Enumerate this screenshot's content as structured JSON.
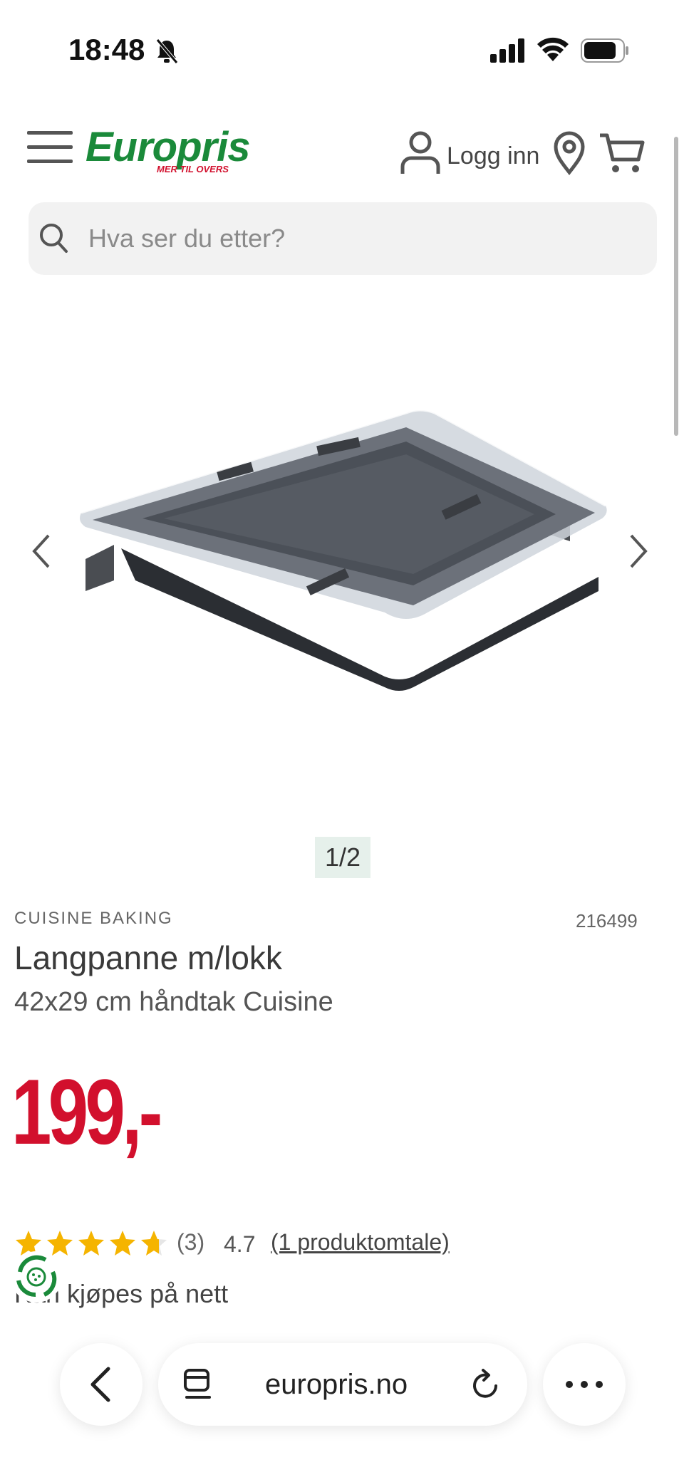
{
  "status_bar": {
    "time": "18:48",
    "icons": [
      "bell-slash-icon",
      "signal-icon",
      "wifi-icon",
      "battery-icon"
    ]
  },
  "header": {
    "logo_text": "Europris",
    "logo_tagline": "MER TIL OVERS",
    "login_label": "Logg inn",
    "brand_green": "#1a8a3a",
    "brand_red": "#d2102d"
  },
  "search": {
    "placeholder": "Hva ser du etter?"
  },
  "gallery": {
    "pager": "1/2"
  },
  "product": {
    "brand": "CUISINE BAKING",
    "sku": "216499",
    "title": "Langpanne m/lokk",
    "subtitle": "42x29 cm håndtak Cuisine",
    "price": "199,-"
  },
  "rating": {
    "stars": 4.7,
    "count": "(3)",
    "value": "4.7",
    "reviews_link": "(1 produktomtale)",
    "availability": "Kan kjøpes på nett"
  },
  "browser": {
    "url": "europris.no"
  }
}
